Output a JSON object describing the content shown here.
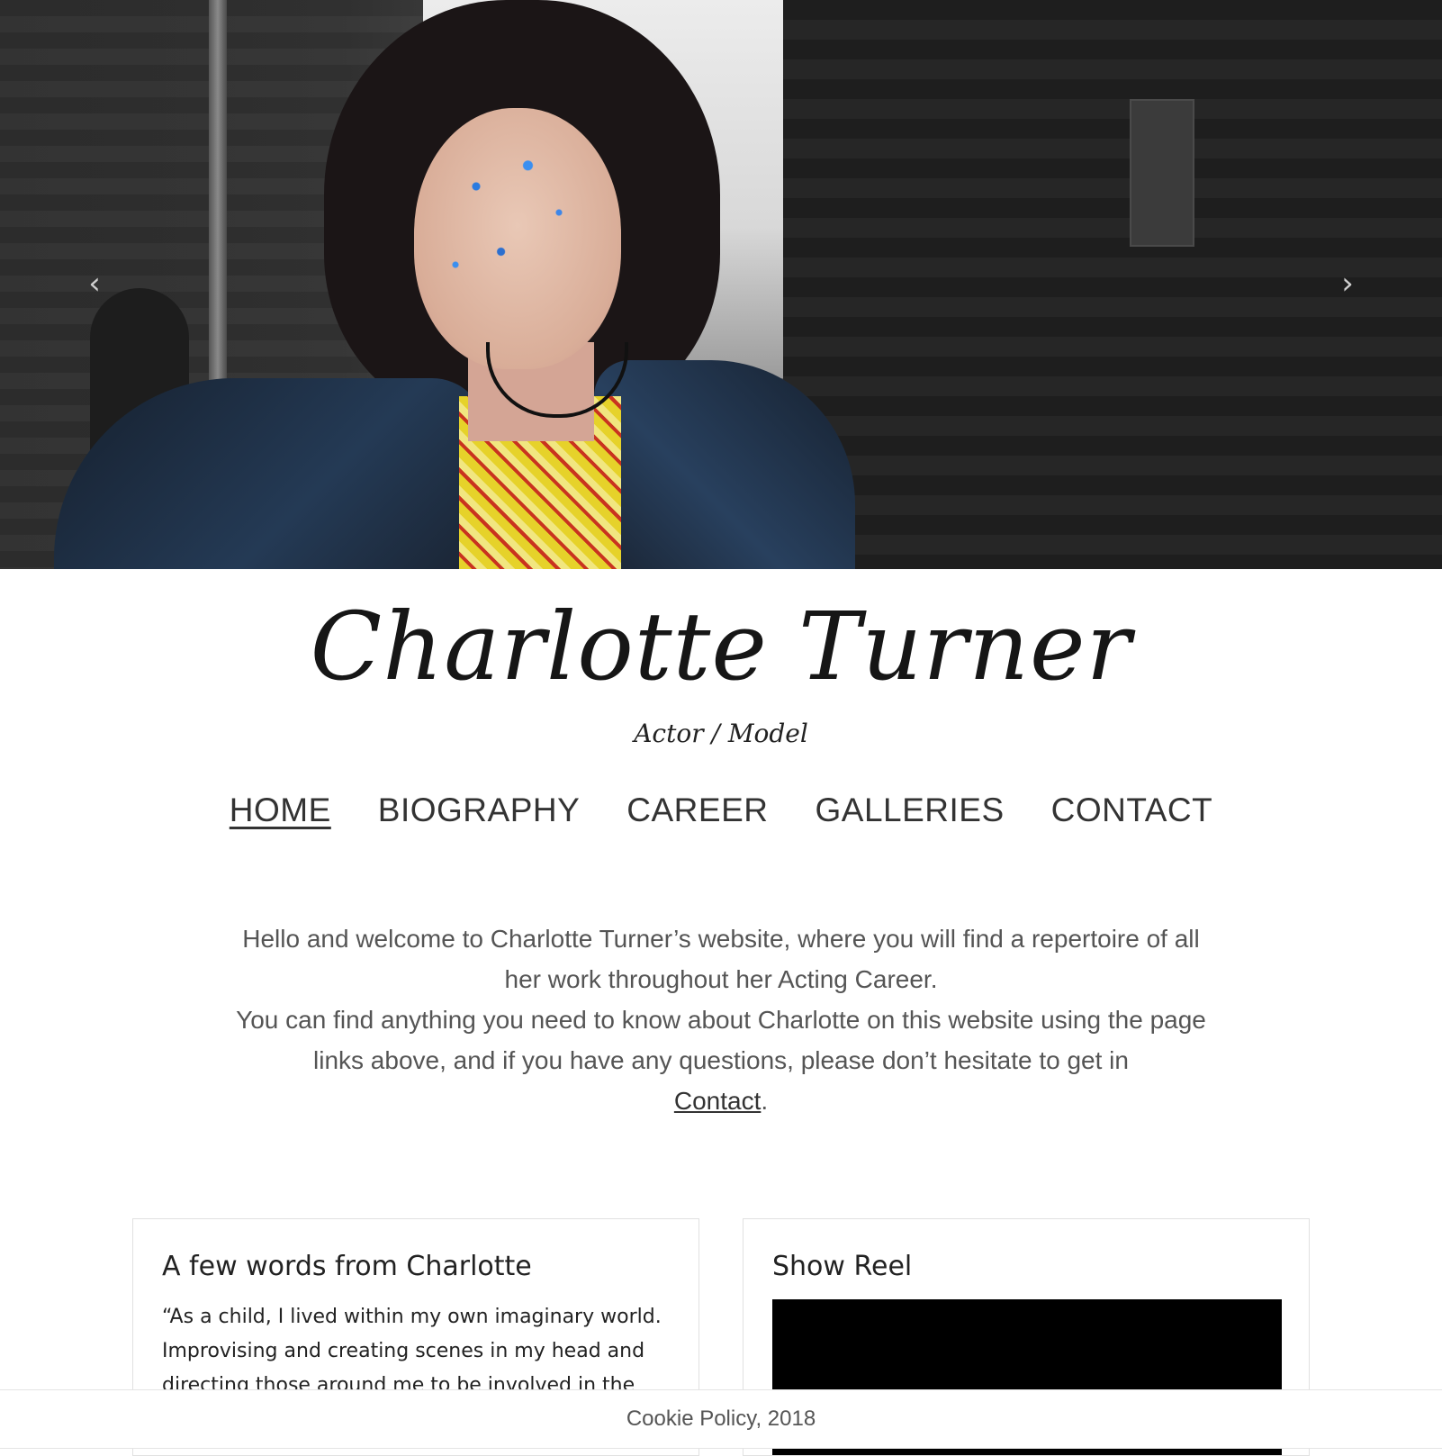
{
  "hero": {
    "prev_arrow": "‹",
    "next_arrow": "›"
  },
  "site": {
    "title": "Charlotte Turner",
    "subtitle": "Actor / Model"
  },
  "nav": {
    "items": [
      {
        "label": "HOME"
      },
      {
        "label": "BIOGRAPHY"
      },
      {
        "label": "CAREER"
      },
      {
        "label": "GALLERIES"
      },
      {
        "label": "CONTACT"
      }
    ],
    "active": "HOME"
  },
  "intro": {
    "line1": "Hello and welcome to Charlotte Turner’s website, where you will find a repertoire of all her work throughout her Acting Career.",
    "line2": "You can find anything you need to know about Charlotte on this website using the page links above, and if you have any questions, please don’t hesitate to get in",
    "contact_link": "Contact",
    "period": "."
  },
  "cards": {
    "words": {
      "title": "A few words from Charlotte",
      "text": "“As a child, I lived within my own imaginary world. Improvising and creating scenes in my head and directing those around me to be involved in the"
    },
    "reel": {
      "title": "Show Reel"
    }
  },
  "footer": {
    "cookie_text": "Cookie Policy, 2018"
  },
  "colors": {
    "text": "#222222",
    "muted": "#555555",
    "video_bg": "#000000"
  }
}
